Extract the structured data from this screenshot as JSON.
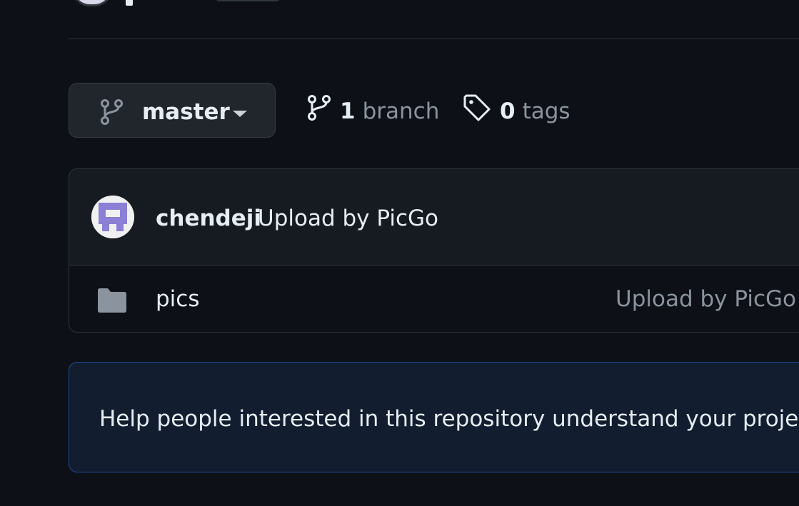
{
  "branch_selector": {
    "current_branch": "master"
  },
  "meta": {
    "branch_count": "1",
    "branch_word": "branch",
    "tag_count": "0",
    "tag_word": "tags"
  },
  "latest_commit": {
    "author": "chendeji",
    "message": "Upload by PicGo"
  },
  "files": [
    {
      "name": "pics",
      "type": "folder",
      "commit_message": "Upload by PicGo"
    }
  ],
  "readme_prompt": {
    "text": "Help people interested in this repository understand your project"
  },
  "colors": {
    "background": "#0d1117",
    "muted_text": "#8b949e",
    "accent_border": "#1f4b8f",
    "avatar_purple": "#8b7fd6"
  },
  "icons": {
    "branch": "git-branch-icon",
    "tag": "tag-icon",
    "folder": "folder-icon",
    "caret": "caret-down-icon"
  }
}
